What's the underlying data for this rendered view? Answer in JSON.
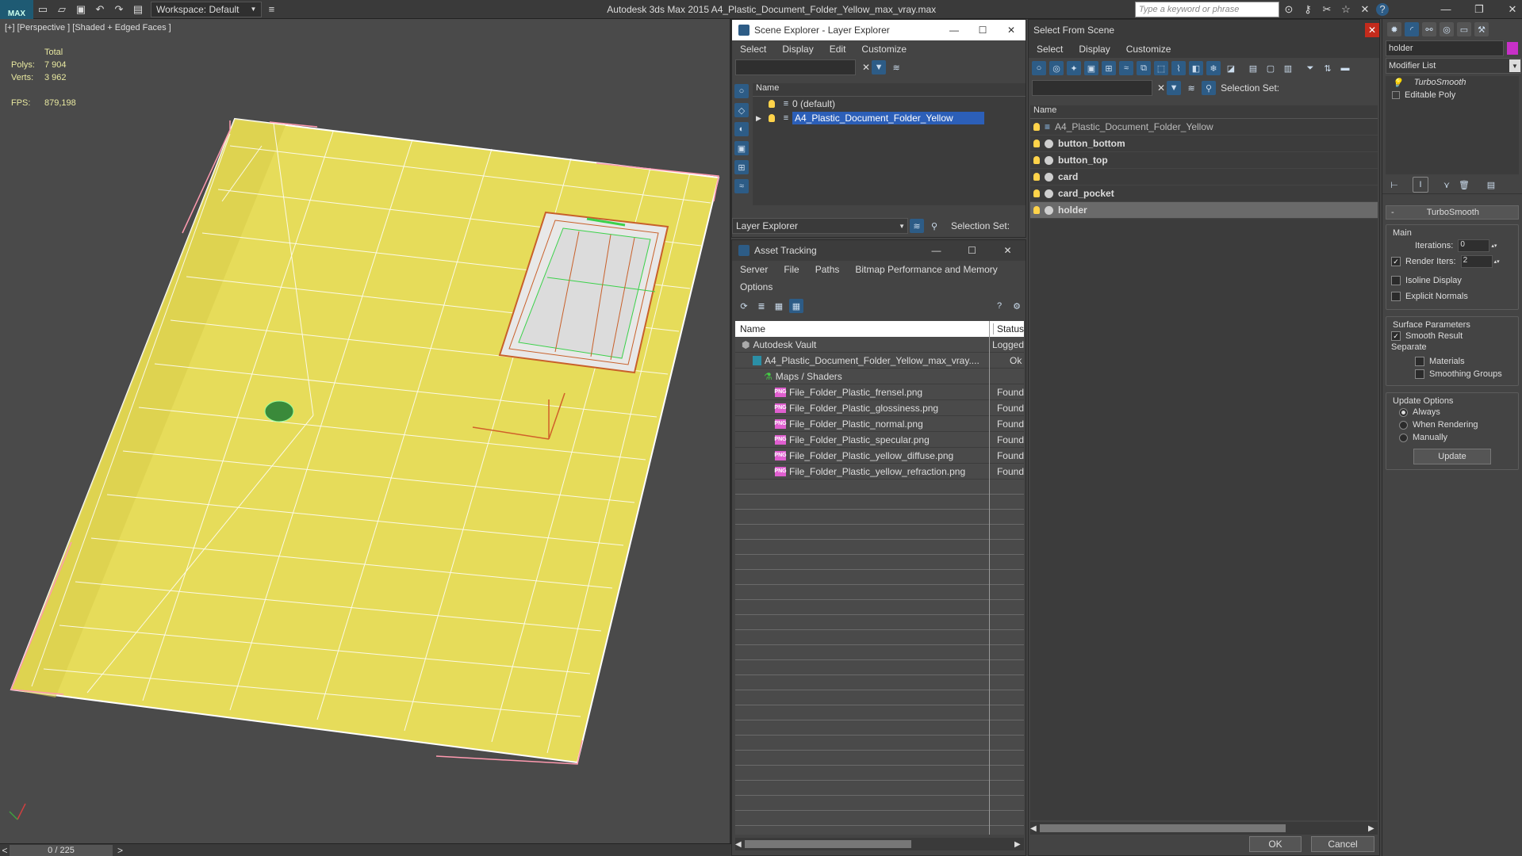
{
  "titlebar": {
    "logo": "MAX",
    "workspace": "Workspace: Default",
    "app_title": "Autodesk 3ds Max  2015     A4_Plastic_Document_Folder_Yellow_max_vray.max",
    "search_placeholder": "Type a keyword or phrase"
  },
  "viewport": {
    "label": "[+] [Perspective ] [Shaded + Edged Faces ]",
    "stats": {
      "total": "Total",
      "polys_label": "Polys:",
      "polys": "7 904",
      "verts_label": "Verts:",
      "verts": "3 962",
      "fps_label": "FPS:",
      "fps": "879,198"
    },
    "timeline": "0 / 225",
    "colors": {
      "folder": "#e6dc5a",
      "wire": "#ffffff",
      "bbox": "#ff9ab0"
    }
  },
  "layer_explorer": {
    "title": "Scene Explorer - Layer Explorer",
    "menu": [
      "Select",
      "Display",
      "Edit",
      "Customize"
    ],
    "column": "Name",
    "layers": [
      {
        "name": "0 (default)",
        "selected": false
      },
      {
        "name": "A4_Plastic_Document_Folder_Yellow",
        "selected": true
      }
    ],
    "footer_dropdown": "Layer Explorer",
    "selection_set": "Selection Set:"
  },
  "asset_tracking": {
    "title": "Asset Tracking",
    "menu": [
      "Server",
      "File",
      "Paths",
      "Bitmap Performance and Memory"
    ],
    "menu2": "Options",
    "col_name": "Name",
    "col_status": "Status",
    "rows": [
      {
        "name": "Autodesk Vault",
        "status": "Logged",
        "indent": 0,
        "icon": "vault"
      },
      {
        "name": "A4_Plastic_Document_Folder_Yellow_max_vray....",
        "status": "Ok",
        "indent": 1,
        "icon": "max"
      },
      {
        "name": "Maps / Shaders",
        "status": "",
        "indent": 2,
        "icon": "maps"
      },
      {
        "name": "File_Folder_Plastic_frensel.png",
        "status": "Found",
        "indent": 3,
        "icon": "png"
      },
      {
        "name": "File_Folder_Plastic_glossiness.png",
        "status": "Found",
        "indent": 3,
        "icon": "png"
      },
      {
        "name": "File_Folder_Plastic_normal.png",
        "status": "Found",
        "indent": 3,
        "icon": "png"
      },
      {
        "name": "File_Folder_Plastic_specular.png",
        "status": "Found",
        "indent": 3,
        "icon": "png"
      },
      {
        "name": "File_Folder_Plastic_yellow_diffuse.png",
        "status": "Found",
        "indent": 3,
        "icon": "png"
      },
      {
        "name": "File_Folder_Plastic_yellow_refraction.png",
        "status": "Found",
        "indent": 3,
        "icon": "png"
      }
    ]
  },
  "select_from_scene": {
    "title": "Select From Scene",
    "menu": [
      "Select",
      "Display",
      "Customize"
    ],
    "selection_set": "Selection Set:",
    "column": "Name",
    "items": [
      {
        "name": "A4_Plastic_Document_Folder_Yellow",
        "bold": false,
        "selected": false,
        "icon": "layer"
      },
      {
        "name": "button_bottom",
        "bold": true,
        "selected": false,
        "icon": "teapot"
      },
      {
        "name": "button_top",
        "bold": true,
        "selected": false,
        "icon": "teapot"
      },
      {
        "name": "card",
        "bold": true,
        "selected": false,
        "icon": "teapot"
      },
      {
        "name": "card_pocket",
        "bold": true,
        "selected": false,
        "icon": "teapot"
      },
      {
        "name": "holder",
        "bold": true,
        "selected": true,
        "icon": "teapot"
      }
    ],
    "ok": "OK",
    "cancel": "Cancel"
  },
  "command_panel": {
    "object_name": "holder",
    "object_color": "#c830c8",
    "modifier_list": "Modifier List",
    "stack": [
      "TurboSmooth",
      "Editable Poly"
    ],
    "rollout": "TurboSmooth",
    "main": "Main",
    "iterations_label": "Iterations:",
    "iterations": "0",
    "render_iters_label": "Render Iters:",
    "render_iters": "2",
    "isoline": "Isoline Display",
    "explicit": "Explicit Normals",
    "surface": "Surface Parameters",
    "smooth_result": "Smooth Result",
    "separate": "Separate",
    "materials": "Materials",
    "smoothing_groups": "Smoothing Groups",
    "update_options": "Update Options",
    "always": "Always",
    "when_rendering": "When Rendering",
    "manually": "Manually",
    "update": "Update"
  }
}
